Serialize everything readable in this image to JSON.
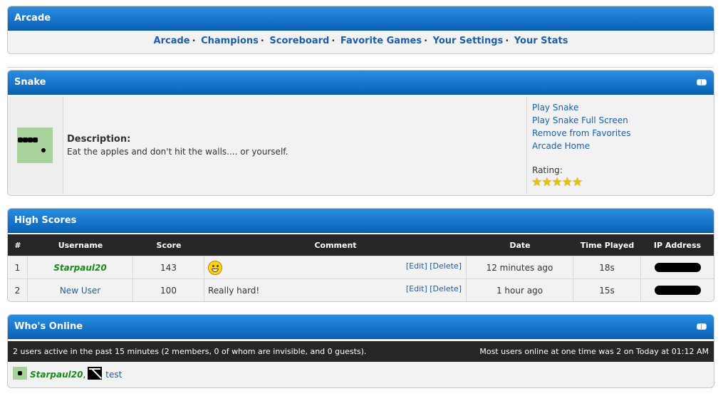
{
  "arcade": {
    "title": "Arcade",
    "nav": [
      "Arcade",
      "Champions",
      "Scoreboard",
      "Favorite Games",
      "Your Settings",
      "Your Stats"
    ],
    "separator": "."
  },
  "game": {
    "title": "Snake",
    "description_label": "Description:",
    "description": "Eat the apples and don't hit the walls.... or yourself.",
    "links": [
      "Play Snake",
      "Play Snake Full Screen",
      "Remove from Favorites",
      "Arcade Home"
    ],
    "rating_label": "Rating:",
    "rating_stars": 5,
    "rating_glyphs": "★★★★★"
  },
  "high_scores": {
    "title": "High Scores",
    "columns": [
      "#",
      "Username",
      "Score",
      "Comment",
      "Date",
      "Time Played",
      "IP Address"
    ],
    "edit_label": "[Edit]",
    "delete_label": "[Delete]",
    "rows": [
      {
        "rank": "1",
        "username": "Starpaul20",
        "score": "143",
        "comment": "",
        "comment_icon": "grin-smiley-icon",
        "date": "12 minutes ago",
        "time_played": "18s"
      },
      {
        "rank": "2",
        "username": "New User",
        "score": "100",
        "comment": "Really hard!",
        "date": "1 hour ago",
        "time_played": "15s"
      }
    ]
  },
  "whos_online": {
    "title": "Who's Online",
    "summary": "2 users active in the past 15 minutes (2 members, 0 of whom are invisible, and 0 guests).",
    "record": "Most users online at one time was 2 on Today at 01:12 AM",
    "users": [
      "Starpaul20",
      "test"
    ],
    "user_separator": ","
  },
  "colors": {
    "header_blue": "#0a62b6",
    "link": "#1c5fa6",
    "admin_green": "#1a8a1a",
    "dark_bar": "#262626"
  }
}
